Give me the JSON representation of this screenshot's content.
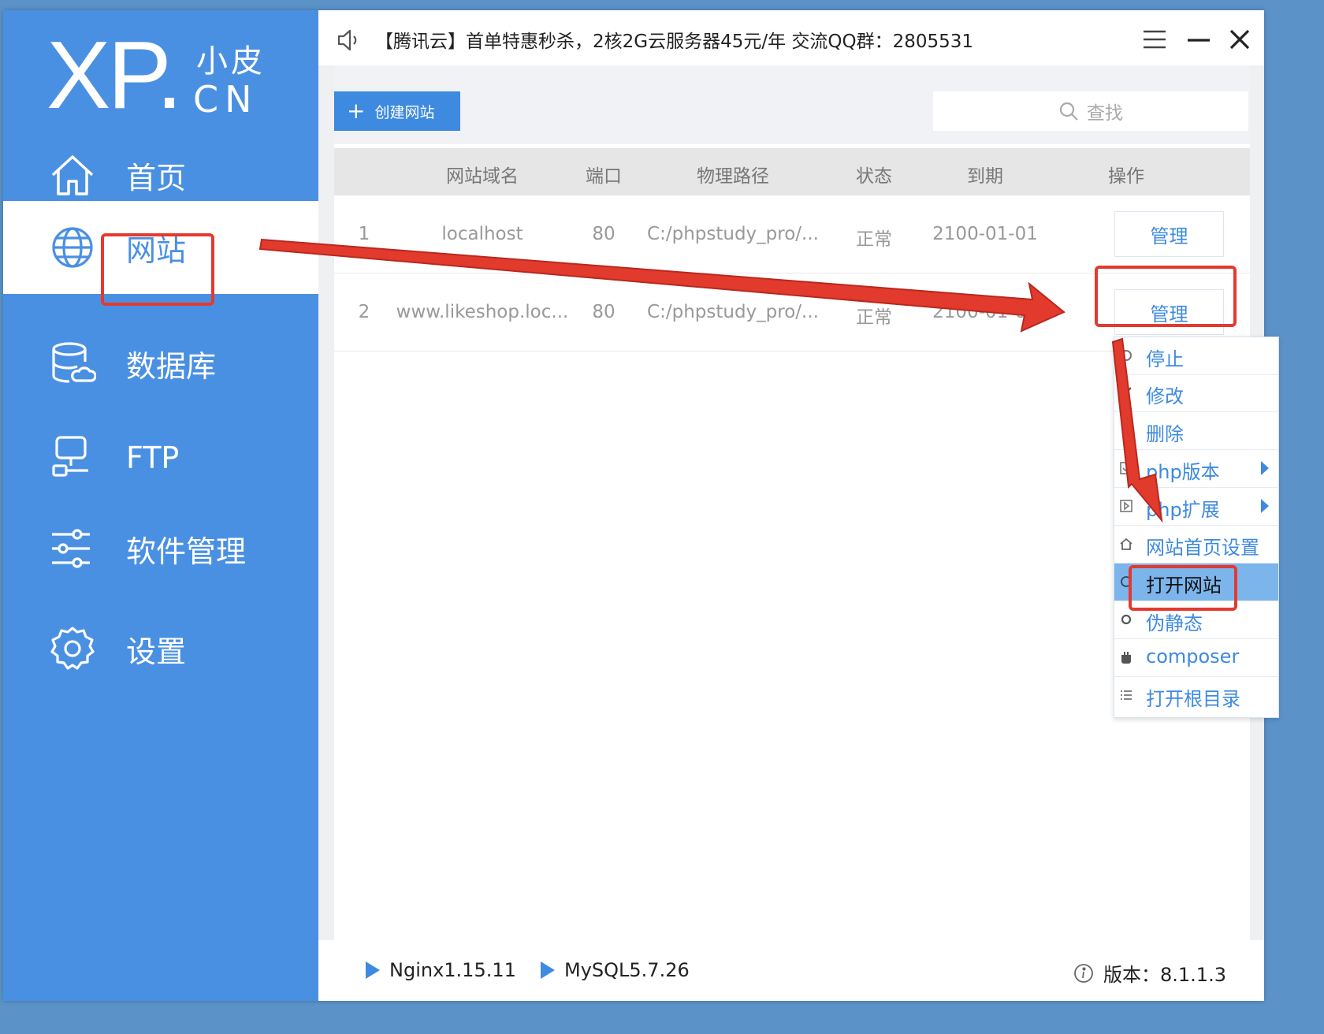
{
  "sidebar": {
    "logo": {
      "main": "XP.",
      "top": "小皮",
      "bottom": "CN"
    },
    "items": [
      {
        "label": "首页",
        "icon": "home-icon"
      },
      {
        "label": "网站",
        "icon": "globe-icon",
        "active": true
      },
      {
        "label": "数据库",
        "icon": "database-icon"
      },
      {
        "label": "FTP",
        "icon": "ftp-server-icon"
      },
      {
        "label": "软件管理",
        "icon": "sliders-icon"
      },
      {
        "label": "设置",
        "icon": "gear-icon"
      }
    ]
  },
  "titlebar": {
    "notice": "【腾讯云】首单特惠秒杀，2核2G云服务器45元/年 交流QQ群：2805531"
  },
  "toolbar": {
    "create_label": "创建网站",
    "search_placeholder": "查找"
  },
  "table": {
    "headers": [
      "网站域名",
      "端口",
      "物理路径",
      "状态",
      "到期",
      "操作"
    ],
    "rows": [
      {
        "index": "1",
        "domain": "localhost",
        "port": "80",
        "path": "C:/phpstudy_pro/...",
        "status": "正常",
        "expiry": "2100-01-01",
        "action": "管理"
      },
      {
        "index": "2",
        "domain": "www.likeshop.loc...",
        "port": "80",
        "path": "C:/phpstudy_pro/...",
        "status": "正常",
        "expiry": "2100-01-07",
        "action": "管理"
      }
    ]
  },
  "menu": {
    "items": [
      {
        "label": "停止",
        "icon": "stop-icon"
      },
      {
        "label": "修改",
        "icon": "edit-icon"
      },
      {
        "label": "删除",
        "icon": "trash-icon"
      },
      {
        "label": "php版本",
        "icon": "php-version-icon",
        "submenu": true
      },
      {
        "label": "php扩展",
        "icon": "php-extension-icon",
        "submenu": true
      },
      {
        "label": "网站首页设置",
        "icon": "homepage-icon"
      },
      {
        "label": "打开网站",
        "icon": "open-site-icon",
        "selected": true
      },
      {
        "label": "伪静态",
        "icon": "rewrite-icon"
      },
      {
        "label": "composer",
        "icon": "composer-icon"
      },
      {
        "label": "打开根目录",
        "icon": "folder-list-icon"
      }
    ]
  },
  "footer": {
    "services": [
      "Nginx1.15.11",
      "MySQL5.7.26"
    ],
    "version": "版本：8.1.1.3"
  },
  "colors": {
    "sidebar": "#4a90e2",
    "accent": "#3d8ae0",
    "annotation": "#e33a2e",
    "menu_selected": "#7cb4ec"
  }
}
